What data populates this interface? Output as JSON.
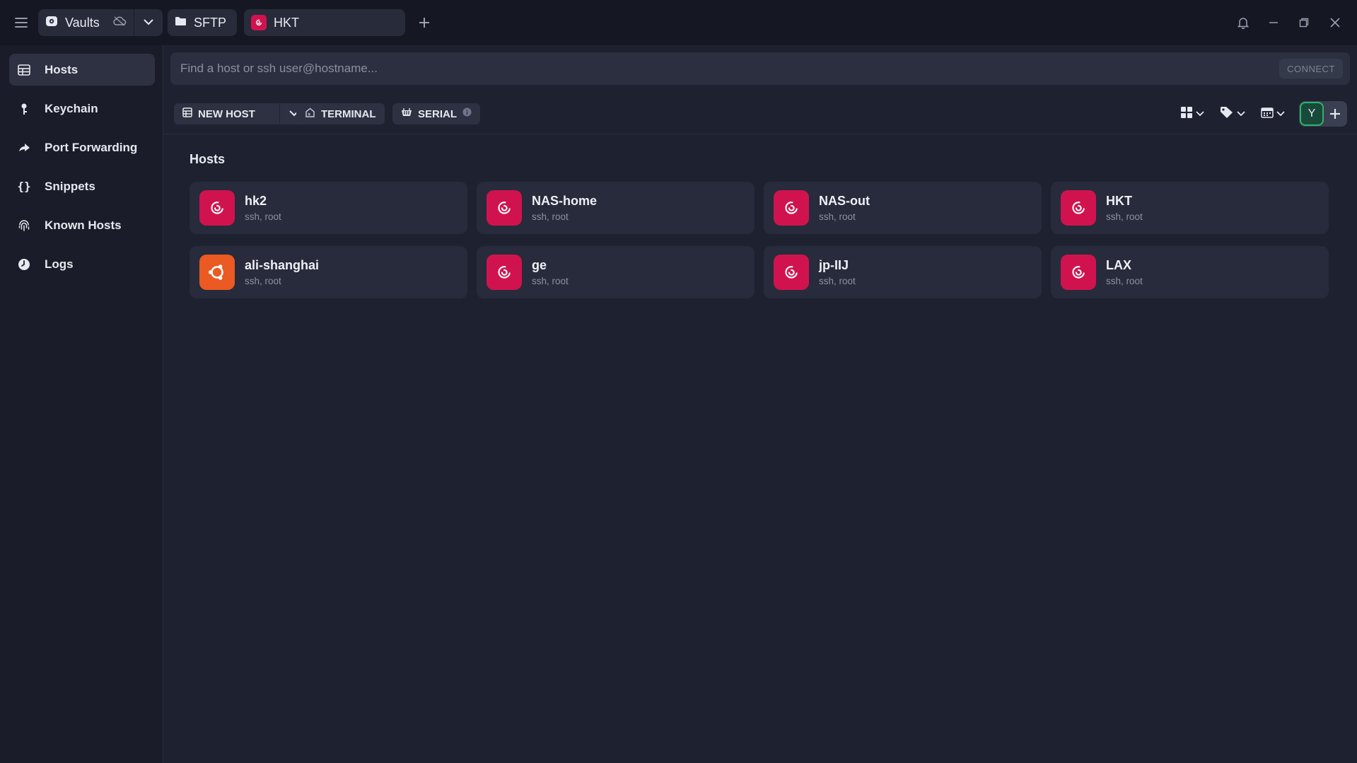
{
  "titlebar": {
    "vault_label": "Vaults",
    "tabs": [
      {
        "label": "SFTP"
      },
      {
        "label": "HKT"
      }
    ]
  },
  "sidebar": {
    "items": [
      {
        "label": "Hosts",
        "icon": "hosts-grid-icon",
        "active": true
      },
      {
        "label": "Keychain",
        "icon": "key-icon"
      },
      {
        "label": "Port Forwarding",
        "icon": "port-forward-icon"
      },
      {
        "label": "Snippets",
        "icon": "braces-icon"
      },
      {
        "label": "Known Hosts",
        "icon": "fingerprint-icon"
      },
      {
        "label": "Logs",
        "icon": "clock-icon"
      }
    ]
  },
  "search": {
    "placeholder": "Find a host or ssh user@hostname...",
    "connect_label": "CONNECT"
  },
  "toolbar": {
    "new_host_label": "NEW HOST",
    "terminal_label": "TERMINAL",
    "serial_label": "SERIAL",
    "avatar_initial": "Y"
  },
  "main": {
    "section_title": "Hosts",
    "hosts": [
      {
        "name": "hk2",
        "sub": "ssh, root",
        "os": "debian"
      },
      {
        "name": "NAS-home",
        "sub": "ssh, root",
        "os": "debian"
      },
      {
        "name": "NAS-out",
        "sub": "ssh, root",
        "os": "debian"
      },
      {
        "name": "HKT",
        "sub": "ssh, root",
        "os": "debian"
      },
      {
        "name": "ali-shanghai",
        "sub": "ssh, root",
        "os": "ubuntu"
      },
      {
        "name": "ge",
        "sub": "ssh, root",
        "os": "debian"
      },
      {
        "name": "jp-IIJ",
        "sub": "ssh, root",
        "os": "debian"
      },
      {
        "name": "LAX",
        "sub": "ssh, root",
        "os": "debian"
      }
    ]
  },
  "colors": {
    "debian": "#d0134f",
    "ubuntu": "#ea5a22",
    "avatar_border": "#2fb36b"
  }
}
